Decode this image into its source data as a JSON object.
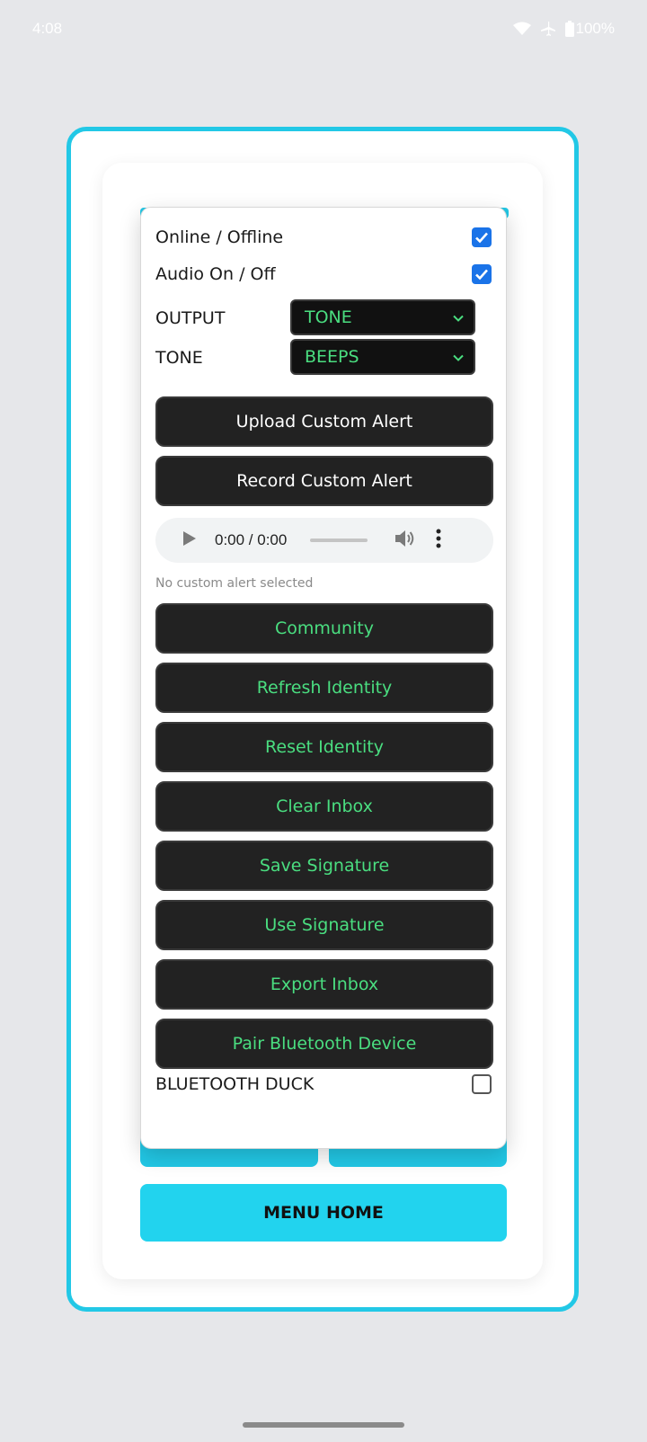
{
  "status_bar": {
    "time": "4:08",
    "battery": "100%"
  },
  "panel": {
    "online_label": "Online / Offline",
    "online_checked": true,
    "audio_label": "Audio On / Off",
    "audio_checked": true,
    "output_label": "OUTPUT",
    "output_value": "TONE",
    "tone_label": "TONE",
    "tone_value": "BEEPS",
    "upload_button": "Upload Custom Alert",
    "record_button": "Record Custom Alert",
    "audio_player": {
      "time": "0:00 / 0:00"
    },
    "alert_status": "No custom alert selected",
    "buttons": {
      "community": "Community",
      "refresh_identity": "Refresh Identity",
      "reset_identity": "Reset Identity",
      "clear_inbox": "Clear Inbox",
      "save_signature": "Save Signature",
      "use_signature": "Use Signature",
      "export_inbox": "Export Inbox",
      "pair_bluetooth": "Pair Bluetooth Device"
    },
    "bluetooth_duck_label": "BLUETOOTH DUCK",
    "bluetooth_duck_checked": false
  },
  "menu_home_label": "MENU HOME",
  "colors": {
    "accent": "#22d3ee",
    "button_text_green": "#4ade80",
    "button_bg": "#222222",
    "checkbox_blue": "#1a73e8"
  },
  "icons": [
    "wifi-icon",
    "airplane-icon",
    "battery-icon",
    "chevron-down-icon",
    "play-icon",
    "volume-icon",
    "more-vert-icon",
    "check-icon"
  ]
}
